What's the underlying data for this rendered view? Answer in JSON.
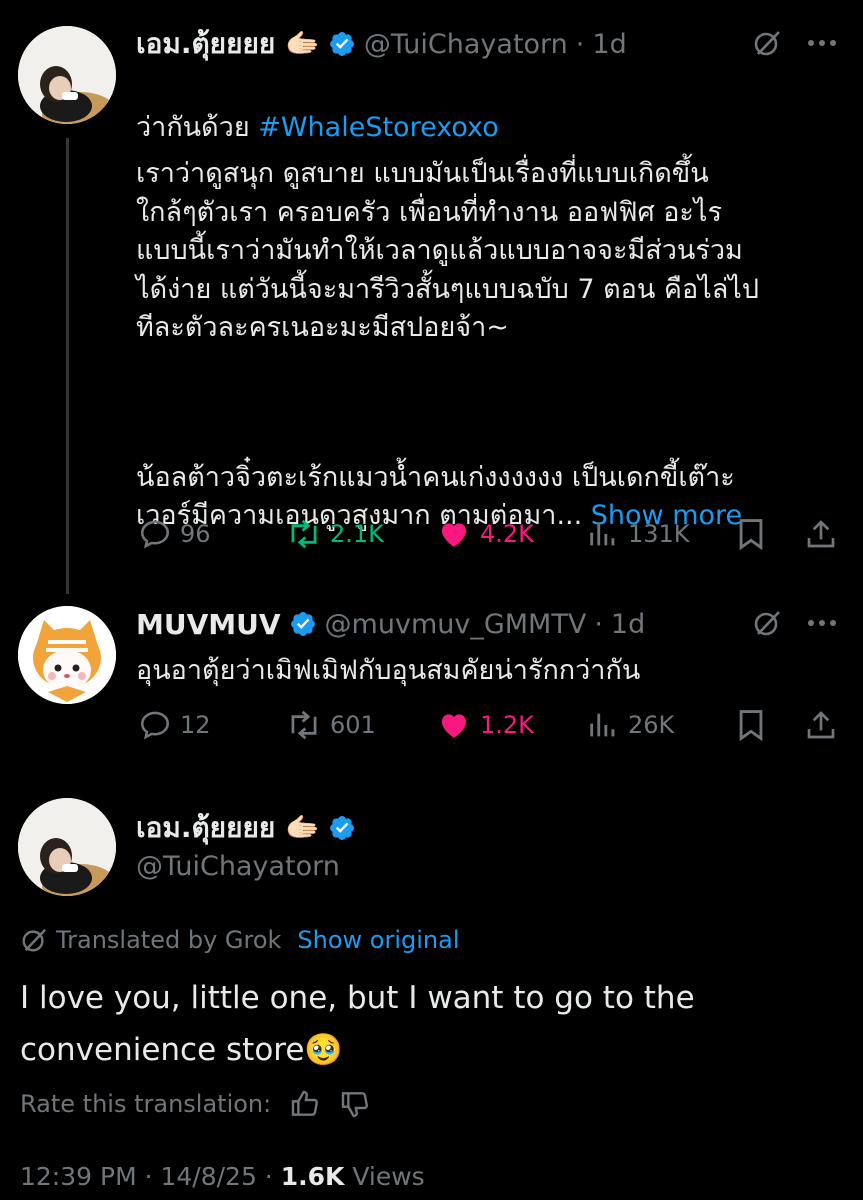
{
  "tweet1": {
    "display_name": "เอม.ตุ้ยยยย 🫱🏻",
    "handle": "@TuiChayatorn",
    "dot": "·",
    "time": "1d",
    "first_line_prefix": "ว่ากันด้วย ",
    "hashtag": "#WhaleStorexoxo",
    "paragraph1": "เราว่าดูสนุก ดูสบาย แบบมันเป็นเรื่องที่แบบเกิดขึ้น\nใกล้ๆตัวเรา ครอบครัว เพื่อนที่ทำงาน ออฟฟิศ อะไร\nแบบนี้เราว่ามันทำให้เวลาดูแล้วแบบอาจจะมีส่วนร่วม\nได้ง่าย แต่วันนี้จะมารีวิวสั้นๆแบบฉบับ 7 ตอน คือไล่ไป\nทีละตัวละครเนอะมะมีสปอยจ้า~",
    "paragraph2": "น้อลต้าวจิ๋วตะเร้กแมวน้ำคนเก่งงงงงง เป็นเดกขี้เต๊าะ\nเวอร์มีความเอนดูวสูงมาก ตามต่อมา...",
    "show_more": "Show more",
    "replies": "96",
    "reposts": "2.1K",
    "likes": "4.2K",
    "views": "131K"
  },
  "tweet2": {
    "display_name": "MUVMUV",
    "handle": "@muvmuv_GMMTV",
    "dot": "·",
    "time": "1d",
    "text": "อุนอาตุ้ยว่าเมิฟเมิฟกับอุนสมคัยน่ารักกว่ากัน",
    "replies": "12",
    "reposts": "601",
    "likes": "1.2K",
    "views": "26K"
  },
  "main_tweet": {
    "display_name": "เอม.ตุ้ยยยย 🫱🏻",
    "handle": "@TuiChayatorn",
    "translated_by": "Translated by Grok",
    "show_original": "Show original",
    "text": "I love you, little one, but I want to go to the\nconvenience store🥹",
    "rate_label": "Rate this translation:",
    "timestamp": "12:39 PM · 14/8/25 · ",
    "view_count": "1.6K",
    "views_label": " Views"
  },
  "colors": {
    "accent": "#1d9bf0",
    "repost": "#00ba7c",
    "like": "#f91880",
    "muted": "#71767b"
  },
  "icons": [
    "grok-icon",
    "more-icon",
    "reply-icon",
    "repost-icon",
    "like-icon",
    "views-icon",
    "bookmark-icon",
    "share-icon",
    "verified-icon",
    "thumbs-up-icon",
    "thumbs-down-icon"
  ]
}
